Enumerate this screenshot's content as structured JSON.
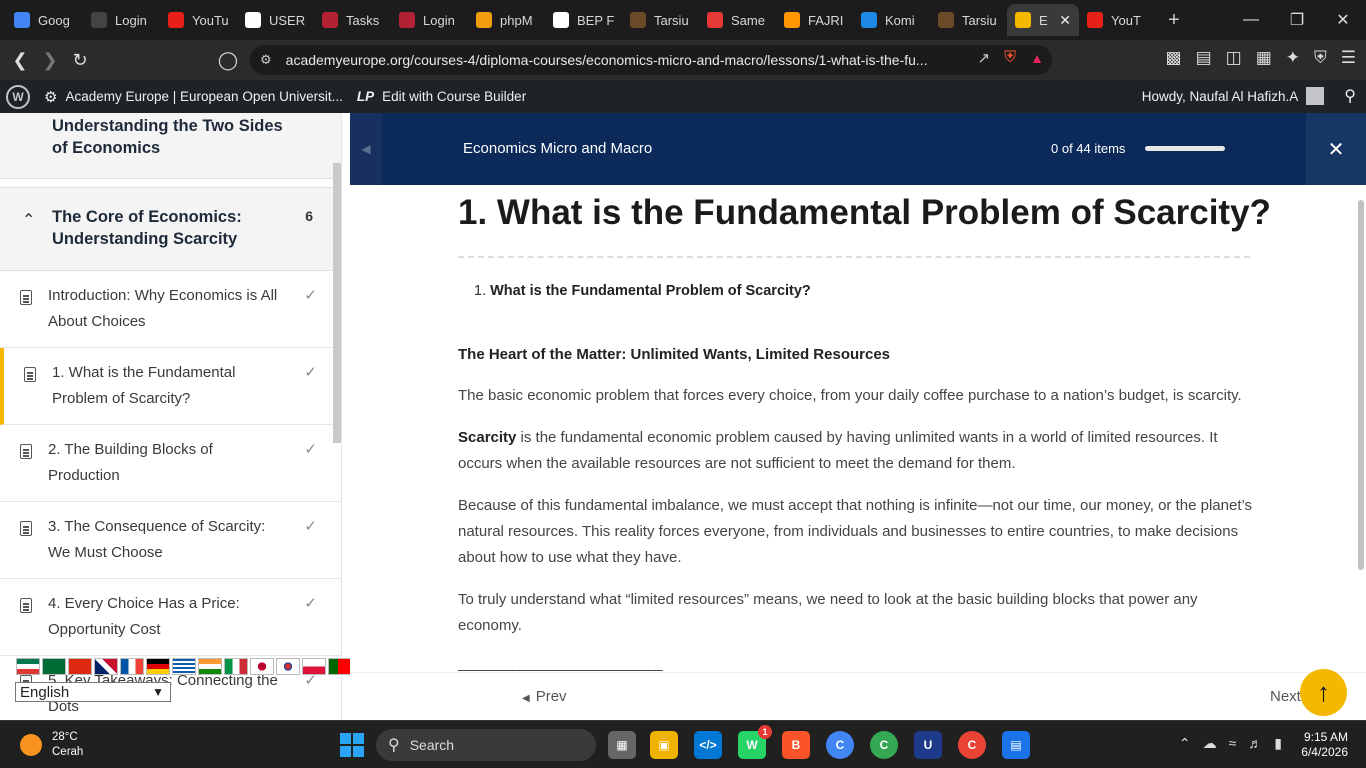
{
  "browser": {
    "tabs": [
      {
        "label": "Goog",
        "color": "#4285f4",
        "icon": "google-docs-icon"
      },
      {
        "label": "Login",
        "color": "#444444",
        "icon": "login-icon"
      },
      {
        "label": "YouTu",
        "color": "#e62117",
        "icon": "youtube-music-icon"
      },
      {
        "label": "USER",
        "color": "#ffffff",
        "icon": "user-page-icon"
      },
      {
        "label": "Tasks",
        "color": "#b22234",
        "icon": "flag-icon"
      },
      {
        "label": "Login",
        "color": "#b22234",
        "icon": "flag-icon"
      },
      {
        "label": "phpM",
        "color": "#f39c12",
        "icon": "phpmyadmin-icon"
      },
      {
        "label": "BEP F",
        "color": "#ffffff",
        "icon": "openai-icon"
      },
      {
        "label": "Tarsiu",
        "color": "#6b4a2a",
        "icon": "tarsius-icon"
      },
      {
        "label": "Same",
        "color": "#e53935",
        "icon": "s-icon"
      },
      {
        "label": "FAJRI",
        "color": "#ff9800",
        "icon": "gear-icon"
      },
      {
        "label": "Komi",
        "color": "#1e88e5",
        "icon": "k-icon"
      },
      {
        "label": "Tarsiu",
        "color": "#6b4a2a",
        "icon": "tarsius-icon"
      },
      {
        "label": "E",
        "color": "#f5b800",
        "icon": "academy-icon",
        "active": true
      },
      {
        "label": "YouT",
        "color": "#e62117",
        "icon": "youtube-icon"
      }
    ],
    "url": "academyeurope.org/courses-4/diploma-courses/economics-micro-and-macro/lessons/1-what-is-the-fu..."
  },
  "wpbar": {
    "site_name": "Academy Europe | European Open Universit...",
    "builder": "Edit with Course Builder",
    "greeting": "Howdy, Naufal Al Hafizh.A"
  },
  "sidebar": {
    "prev_section_title": "Understanding the Two Sides of Economics",
    "section_title": "The Core of Economics: Understanding Scarcity",
    "section_count": "6",
    "lessons": [
      {
        "title": "Introduction: Why Economics is All About Choices",
        "done": true
      },
      {
        "title": "1. What is the Fundamental Problem of Scarcity?",
        "done": true,
        "active": true
      },
      {
        "title": "2. The Building Blocks of Production",
        "done": true
      },
      {
        "title": "3. The Consequence of Scarcity: We Must Choose",
        "done": true
      },
      {
        "title": "4. Every Choice Has a Price: Opportunity Cost",
        "done": true
      },
      {
        "title": "5. Key Takeaways: Connecting the Dots",
        "done": true
      }
    ],
    "language": "English"
  },
  "course_header": {
    "title": "Economics Micro and Macro",
    "progress_text": "0 of 44 items",
    "progress_value": 0
  },
  "content": {
    "h1": "1. What is the Fundamental Problem of Scarcity?",
    "toc_num": "1.",
    "toc_item": "What is the Fundamental Problem of Scarcity?",
    "subheading": "The Heart of the Matter: Unlimited Wants, Limited Resources",
    "p1": "The basic economic problem that forces every choice, from your daily coffee purchase to a nation’s budget, is scarcity.",
    "p2_bold": "Scarcity",
    "p2_rest": " is the fundamental economic problem caused by having unlimited wants in a world of limited resources. It occurs when the available resources are not sufficient to meet the demand for them.",
    "p3": "Because of this fundamental imbalance, we must accept that nothing is infinite—not our time, our money, or the planet’s natural resources. This reality forces everyone, from individuals and businesses to entire countries, to make decisions about how to use what they have.",
    "p4": "To truly understand what “limited resources” means, we need to look at the basic building blocks that power any economy.",
    "separator": "______________________________"
  },
  "lesson_nav": {
    "prev": "Prev",
    "next": "Next"
  },
  "taskbar": {
    "temp": "28°C",
    "weather": "Cerah",
    "search": "Search",
    "time": "9:15 AM",
    "date": "6/4/2026",
    "whatsapp_badge": "1"
  }
}
